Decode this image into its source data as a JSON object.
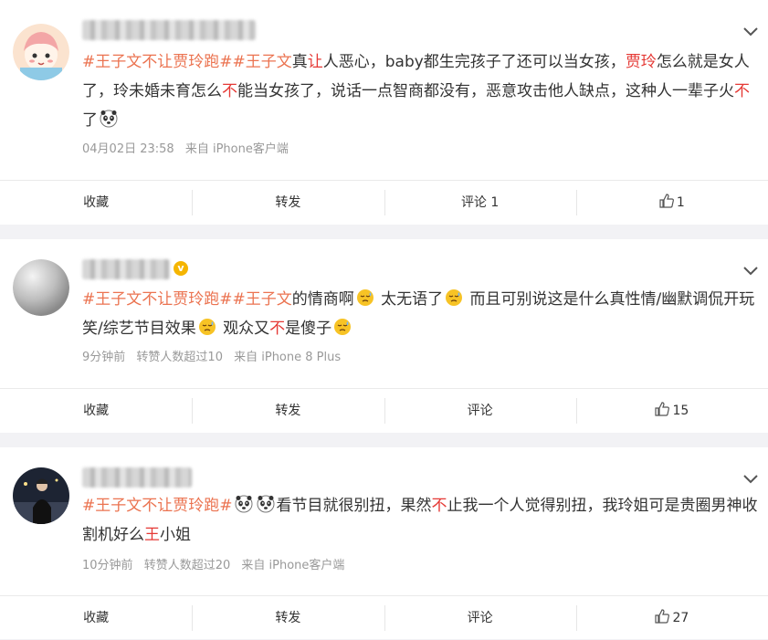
{
  "posts": [
    {
      "content": [
        {
          "t": "#王子文不让贾玲跑#",
          "c": "tag"
        },
        {
          "t": "#王子文",
          "c": "tag"
        },
        {
          "t": "真"
        },
        {
          "t": "让",
          "c": "hl"
        },
        {
          "t": "人恶心，baby都生完孩子了还可以当女孩，"
        },
        {
          "t": "贾玲",
          "c": "hl"
        },
        {
          "t": "怎么就是女人了，玲未婚未育怎么"
        },
        {
          "t": "不",
          "c": "hl"
        },
        {
          "t": "能当女孩了，说话一点智商都没有，恶意攻击他人缺点，这种人一辈子火"
        },
        {
          "t": "不",
          "c": "hl"
        },
        {
          "t": "了"
        },
        {
          "emoji": "panda-emoji"
        }
      ],
      "meta": [
        "04月02日 23:58",
        "来自 iPhone客户端"
      ],
      "actions": {
        "fav": "收藏",
        "repost": "转发",
        "comment": "评论 1",
        "like": "1"
      },
      "verified": false
    },
    {
      "content": [
        {
          "t": "#王子文不让贾玲跑#",
          "c": "tag"
        },
        {
          "t": "#王子文",
          "c": "tag"
        },
        {
          "t": "的情商啊"
        },
        {
          "emoji": "sweat-emoji"
        },
        {
          "t": " 太无语了"
        },
        {
          "emoji": "sweat-emoji"
        },
        {
          "t": " 而且可别说这是什么真性情/幽默调侃开玩笑/综艺节目效果"
        },
        {
          "emoji": "sweat-emoji"
        },
        {
          "t": " 观众又"
        },
        {
          "t": "不",
          "c": "hl"
        },
        {
          "t": "是傻子"
        },
        {
          "emoji": "sweat-emoji"
        }
      ],
      "meta": [
        "9分钟前",
        "转赞人数超过10",
        "来自 iPhone 8 Plus"
      ],
      "actions": {
        "fav": "收藏",
        "repost": "转发",
        "comment": "评论",
        "like": "15"
      },
      "verified": true
    },
    {
      "content": [
        {
          "t": "#王子文不让贾玲跑#",
          "c": "tag"
        },
        {
          "emoji": "panda-emoji"
        },
        {
          "emoji": "panda-emoji"
        },
        {
          "t": "看节目就很别扭，果然"
        },
        {
          "t": "不",
          "c": "hl"
        },
        {
          "t": "止我一个人觉得别扭，我玲姐可是贵圈男神收割机好么"
        },
        {
          "t": "王",
          "c": "hl"
        },
        {
          "t": "小姐"
        }
      ],
      "meta": [
        "10分钟前",
        "转赞人数超过20",
        "来自 iPhone客户端"
      ],
      "actions": {
        "fav": "收藏",
        "repost": "转发",
        "comment": "评论",
        "like": "27"
      },
      "verified": false
    }
  ],
  "colors": {
    "tag": "#eb7350",
    "highlight": "#e53935",
    "meta": "#999999"
  }
}
